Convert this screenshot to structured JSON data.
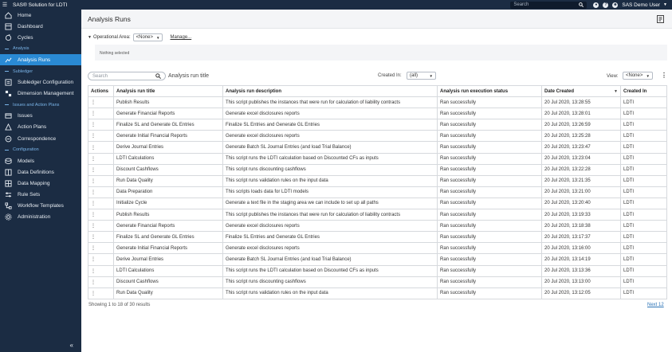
{
  "topbar": {
    "app_title": "SAS® Solution for LDTI",
    "search_placeholder": "Search",
    "user_name": "SAS Demo User"
  },
  "sidebar": {
    "items": [
      {
        "kind": "item",
        "label": "Home",
        "icon": "home-icon"
      },
      {
        "kind": "item",
        "label": "Dashboard",
        "icon": "dashboard-icon"
      },
      {
        "kind": "item",
        "label": "Cycles",
        "icon": "cycles-icon"
      },
      {
        "kind": "section",
        "label": "Analysis"
      },
      {
        "kind": "item",
        "label": "Analysis Runs",
        "icon": "analysis-runs-icon",
        "active": true
      },
      {
        "kind": "section",
        "label": "Subledger"
      },
      {
        "kind": "item",
        "label": "Subledger Configuration",
        "icon": "subledger-config-icon"
      },
      {
        "kind": "item",
        "label": "Dimension Management",
        "icon": "dimension-icon"
      },
      {
        "kind": "section",
        "label": "Issues and Action Plans"
      },
      {
        "kind": "item",
        "label": "Issues",
        "icon": "issues-icon"
      },
      {
        "kind": "item",
        "label": "Action Plans",
        "icon": "action-plans-icon"
      },
      {
        "kind": "item",
        "label": "Correspondence",
        "icon": "correspondence-icon"
      },
      {
        "kind": "section",
        "label": "Configuration"
      },
      {
        "kind": "item",
        "label": "Models",
        "icon": "models-icon"
      },
      {
        "kind": "item",
        "label": "Data Definitions",
        "icon": "data-definitions-icon"
      },
      {
        "kind": "item",
        "label": "Data Mapping",
        "icon": "data-mapping-icon"
      },
      {
        "kind": "item",
        "label": "Rule Sets",
        "icon": "rule-sets-icon"
      },
      {
        "kind": "item",
        "label": "Workflow Templates",
        "icon": "workflow-icon"
      },
      {
        "kind": "item",
        "label": "Administration",
        "icon": "administration-icon"
      }
    ],
    "collapse_glyph": "«"
  },
  "page": {
    "title": "Analysis Runs",
    "operational_area_label": "Operational Area:",
    "operational_area_value": "<None>",
    "manage_link": "Manage...",
    "selection_text": "Nothing selected"
  },
  "toolbar": {
    "search_placeholder": "Search",
    "search_field_label": "Analysis run title",
    "created_in_label": "Created In:",
    "created_in_value": "(all)",
    "view_label": "View:",
    "view_value": "<None>"
  },
  "table": {
    "columns": [
      "Actions",
      "Analysis run title",
      "Analysis run description",
      "Analysis run execution status",
      "Date Created",
      "Created In"
    ],
    "rows": [
      [
        "Publish Results",
        "This script publishes the instances that were run for calculation of liability contracts",
        "Ran successfully",
        "20 Jul 2020, 13:28:55",
        "LDTI"
      ],
      [
        "Generate Financial Reports",
        "Generate excel disclosures reports",
        "Ran successfully",
        "20 Jul 2020, 13:28:01",
        "LDTI"
      ],
      [
        "Finalize SL and Generate GL Entries",
        "Finalize SL Entries and Generate GL Entries",
        "Ran successfully",
        "20 Jul 2020, 13:26:59",
        "LDTI"
      ],
      [
        "Generate Initial Financial Reports",
        "Generate excel disclosures reports",
        "Ran successfully",
        "20 Jul 2020, 13:25:28",
        "LDTI"
      ],
      [
        "Derive Journal Entries",
        "Generate Batch SL Journal Entries (and load Trial Balance)",
        "Ran successfully",
        "20 Jul 2020, 13:23:47",
        "LDTI"
      ],
      [
        "LDTI Calculations",
        "This script runs the LDTI calculation based on Discounted CFs as inputs",
        "Ran successfully",
        "20 Jul 2020, 13:23:04",
        "LDTI"
      ],
      [
        "Discount Cashflows",
        "This script runs discounting cashflows",
        "Ran successfully",
        "20 Jul 2020, 13:22:28",
        "LDTI"
      ],
      [
        "Run Data Quality",
        "This script runs validation rules on the input data",
        "Ran successfully",
        "20 Jul 2020, 13:21:35",
        "LDTI"
      ],
      [
        "Data Preparation",
        "This scripts loads data for LDTI models",
        "Ran successfully",
        "20 Jul 2020, 13:21:00",
        "LDTI"
      ],
      [
        "Initialize Cycle",
        "Generate a text file in the staging area we can include to set up all paths",
        "Ran successfully",
        "20 Jul 2020, 13:20:40",
        "LDTI"
      ],
      [
        "Publish Results",
        "This script publishes the instances that were run for calculation of liability contracts",
        "Ran successfully",
        "20 Jul 2020, 13:19:33",
        "LDTI"
      ],
      [
        "Generate Financial Reports",
        "Generate excel disclosures reports",
        "Ran successfully",
        "20 Jul 2020, 13:18:38",
        "LDTI"
      ],
      [
        "Finalize SL and Generate GL Entries",
        "Finalize SL Entries and Generate GL Entries",
        "Ran successfully",
        "20 Jul 2020, 13:17:37",
        "LDTI"
      ],
      [
        "Generate Initial Financial Reports",
        "Generate excel disclosures reports",
        "Ran successfully",
        "20 Jul 2020, 13:16:00",
        "LDTI"
      ],
      [
        "Derive Journal Entries",
        "Generate Batch SL Journal Entries (and load Trial Balance)",
        "Ran successfully",
        "20 Jul 2020, 13:14:19",
        "LDTI"
      ],
      [
        "LDTI Calculations",
        "This script runs the LDTI calculation based on Discounted CFs as inputs",
        "Ran successfully",
        "20 Jul 2020, 13:13:36",
        "LDTI"
      ],
      [
        "Discount Cashflows",
        "This script runs discounting cashflows",
        "Ran successfully",
        "20 Jul 2020, 13:13:00",
        "LDTI"
      ],
      [
        "Run Data Quality",
        "This script runs validation rules on the input data",
        "Ran successfully",
        "20 Jul 2020, 13:12:05",
        "LDTI"
      ]
    ],
    "action_glyph": "⋮",
    "sort_glyph": "▼"
  },
  "footer": {
    "showing": "Showing 1 to 18 of 30 results",
    "next": "Next 12"
  }
}
